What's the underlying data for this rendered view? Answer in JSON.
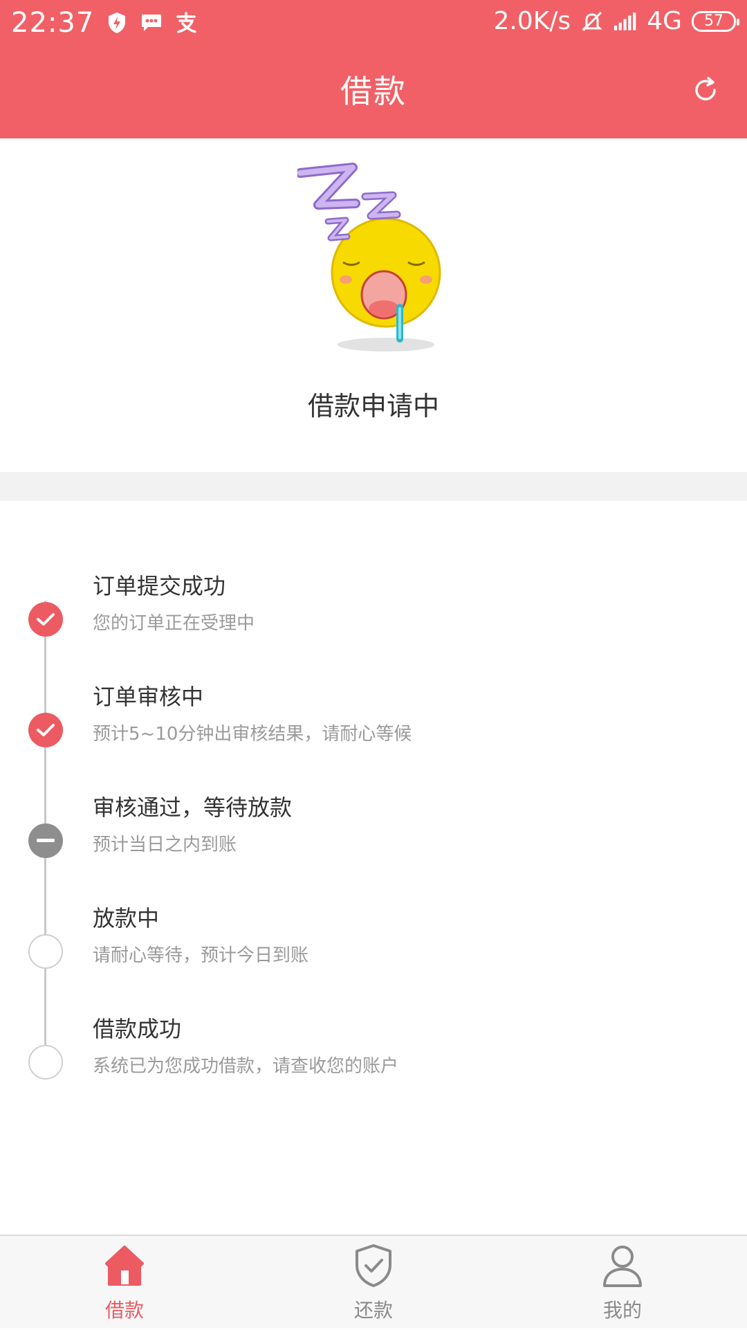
{
  "status_bar": {
    "time": "22:37",
    "net_speed": "2.0K/s",
    "network": "4G",
    "battery": "57"
  },
  "header": {
    "title": "借款"
  },
  "hero": {
    "status_text": "借款申请中"
  },
  "timeline": {
    "steps": [
      {
        "title": "订单提交成功",
        "desc": "您的订单正在受理中",
        "state": "done"
      },
      {
        "title": "订单审核中",
        "desc": "预计5~10分钟出审核结果，请耐心等候",
        "state": "done"
      },
      {
        "title": "审核通过，等待放款",
        "desc": "预计当日之内到账",
        "state": "current"
      },
      {
        "title": "放款中",
        "desc": "请耐心等待，预计今日到账",
        "state": "pending"
      },
      {
        "title": "借款成功",
        "desc": "系统已为您成功借款，请查收您的账户",
        "state": "pending"
      }
    ]
  },
  "tabbar": {
    "items": [
      {
        "label": "借款",
        "icon": "home-icon",
        "active": true
      },
      {
        "label": "还款",
        "icon": "shield-check-icon",
        "active": false
      },
      {
        "label": "我的",
        "icon": "user-icon",
        "active": false
      }
    ]
  },
  "colors": {
    "brand": "#F06066",
    "step_done": "#EC5A62",
    "step_current": "#8E8E8E",
    "tab_active": "#EC5A62",
    "tab_inactive": "#8A8A8A"
  }
}
